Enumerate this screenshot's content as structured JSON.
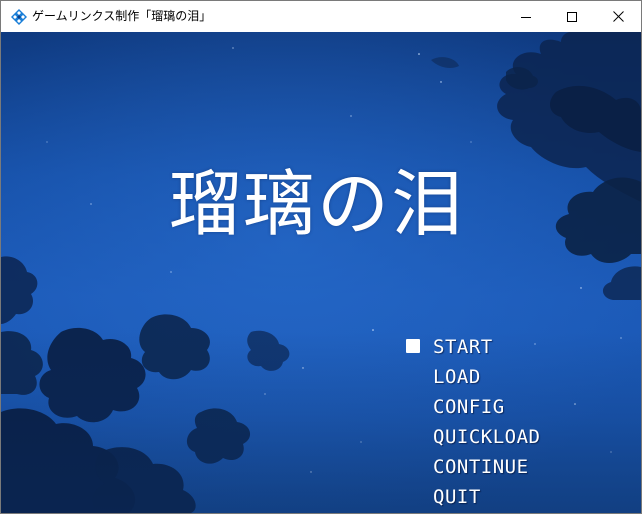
{
  "window": {
    "title": "ゲームリンクス制作「瑠璃の泪」",
    "app_icon": "diamond-grid-icon",
    "controls": {
      "minimize": "minimize-icon",
      "maximize": "maximize-icon",
      "close": "close-icon"
    }
  },
  "game": {
    "title": "瑠璃の泪"
  },
  "menu": {
    "selected_index": 0,
    "items": [
      {
        "label": "START"
      },
      {
        "label": "LOAD"
      },
      {
        "label": "CONFIG"
      },
      {
        "label": "QUICKLOAD"
      },
      {
        "label": "CONTINUE"
      },
      {
        "label": "QUIT"
      }
    ]
  },
  "colors": {
    "sky_dark": "#0f3a80",
    "sky_mid": "#1c5ab8",
    "cloud_dark": "#0b2347",
    "text": "#ffffff"
  }
}
